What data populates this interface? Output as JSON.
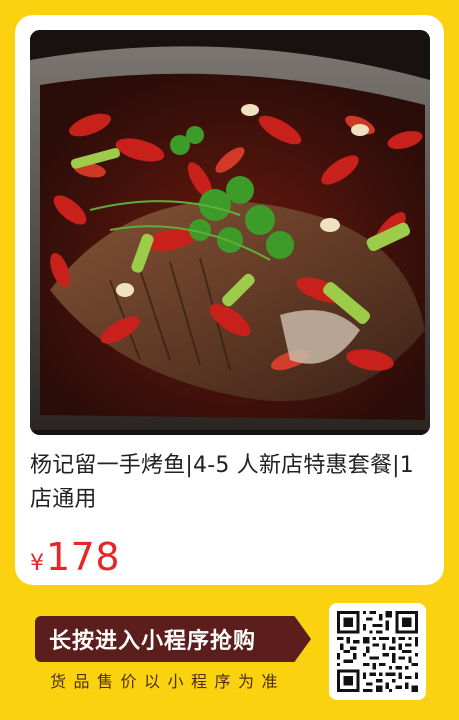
{
  "product": {
    "title": "杨记留一手烤鱼|4-5 人新店特惠套餐|1店通用",
    "currency_symbol": "¥",
    "price": "178"
  },
  "cta": {
    "button_label": "长按进入小程序抢购",
    "note": "货品售价以小程序为准"
  },
  "colors": {
    "background": "#fbd20f",
    "price": "#e8262a",
    "cta_bg": "#5c1e1c"
  },
  "icons": {
    "qr": "qr-code-icon"
  }
}
